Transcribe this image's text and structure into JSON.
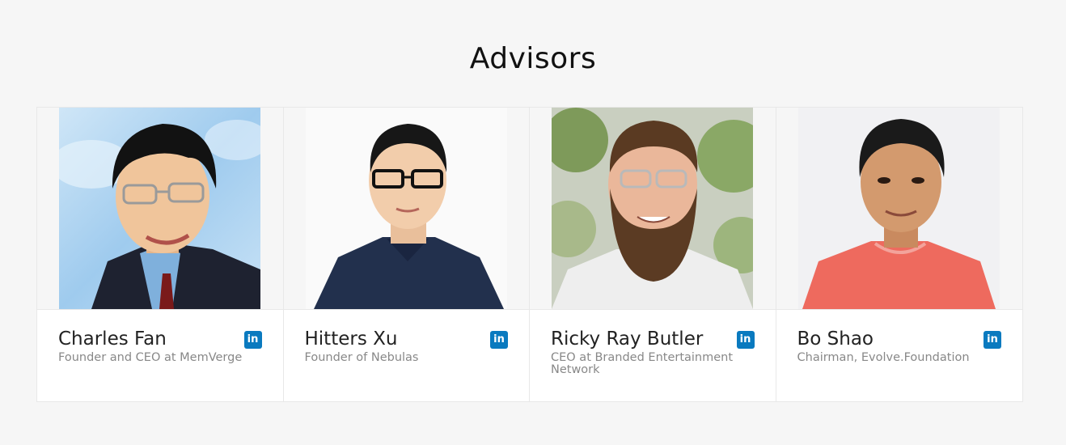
{
  "section": {
    "title": "Advisors"
  },
  "advisors": [
    {
      "name": "Charles Fan",
      "role": "Founder and CEO at MemVerge",
      "linkedin_icon": "linkedin-icon",
      "linkedin_label": "in"
    },
    {
      "name": "Hitters Xu",
      "role": "Founder of Nebulas",
      "linkedin_icon": "linkedin-icon",
      "linkedin_label": "in"
    },
    {
      "name": "Ricky Ray Butler",
      "role": "CEO at Branded Entertainment Network",
      "linkedin_icon": "linkedin-icon",
      "linkedin_label": "in"
    },
    {
      "name": "Bo Shao",
      "role": "Chairman, Evolve.Foundation",
      "linkedin_icon": "linkedin-icon",
      "linkedin_label": "in"
    }
  ],
  "colors": {
    "linkedin": "#0a7abf",
    "background": "#f6f6f6",
    "card": "#ffffff"
  }
}
